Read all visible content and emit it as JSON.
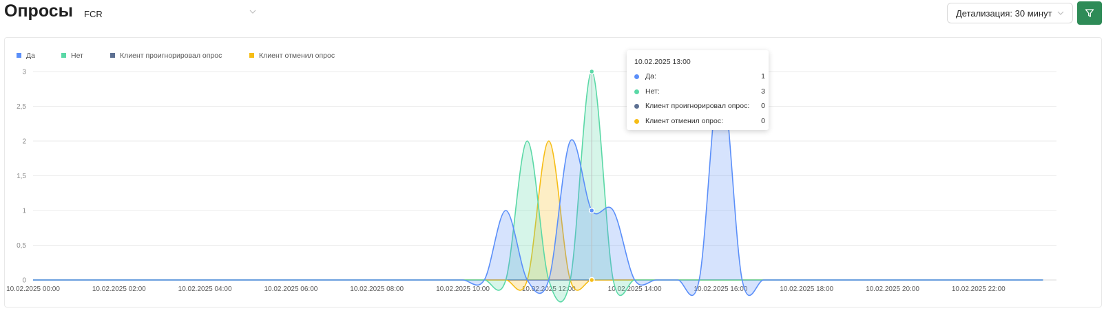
{
  "header": {
    "title": "Опросы",
    "subtitle": "FCR",
    "detail_label": "Детализация: 30 минут"
  },
  "colors": {
    "accent": "#2e8b57",
    "yes": "#5b8ff9",
    "no": "#5ad8a6",
    "ignored": "#5d7092",
    "cancelled": "#f6bd16"
  },
  "icons": {
    "chevron": "chevron-down-icon",
    "filter": "filter-icon"
  },
  "chart_data": {
    "type": "area",
    "ylim": [
      0,
      3
    ],
    "y_ticks": [
      "0",
      "0,5",
      "1",
      "1,5",
      "2",
      "2,5",
      "3"
    ],
    "x_labels": [
      "10.02.2025 00:00",
      "10.02.2025 02:00",
      "10.02.2025 04:00",
      "10.02.2025 06:00",
      "10.02.2025 08:00",
      "10.02.2025 10:00",
      "10.02.2025 12:00",
      "10.02.2025 14:00",
      "10.02.2025 16:00",
      "10.02.2025 18:00",
      "10.02.2025 20:00",
      "10.02.2025 22:00"
    ],
    "x_range": [
      "10.02.2025 00:00",
      "10.02.2025 23:30"
    ],
    "interval": "30 минут",
    "legend_position": "top-left",
    "grid": true,
    "series": [
      {
        "name": "Да",
        "color": "#5b8ff9",
        "points": [
          [
            "10.02.2025 11:00",
            1
          ],
          [
            "10.02.2025 12:30",
            2
          ],
          [
            "10.02.2025 13:00",
            1
          ],
          [
            "10.02.2025 13:30",
            1
          ],
          [
            "10.02.2025 16:00",
            3
          ]
        ]
      },
      {
        "name": "Нет",
        "color": "#5ad8a6",
        "points": [
          [
            "10.02.2025 11:30",
            2
          ],
          [
            "10.02.2025 13:00",
            3
          ]
        ]
      },
      {
        "name": "Клиент проигнорировал опрос",
        "color": "#5d7092",
        "points": []
      },
      {
        "name": "Клиент отменил опрос",
        "color": "#f6bd16",
        "points": [
          [
            "10.02.2025 12:00",
            2
          ]
        ]
      }
    ]
  },
  "tooltip": {
    "title": "10.02.2025 13:00",
    "rows": [
      {
        "label": "Да:",
        "value": "1",
        "color": "#5b8ff9"
      },
      {
        "label": "Нет:",
        "value": "3",
        "color": "#5ad8a6"
      },
      {
        "label": "Клиент проигнорировал опрос:",
        "value": "0",
        "color": "#5d7092"
      },
      {
        "label": "Клиент отменил опрос:",
        "value": "0",
        "color": "#f6bd16"
      }
    ]
  }
}
